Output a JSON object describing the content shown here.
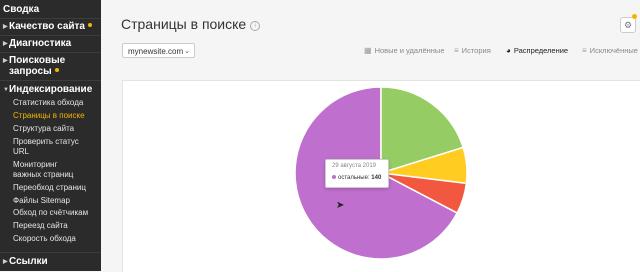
{
  "sidebar": {
    "items": [
      {
        "label": "Сводка"
      },
      {
        "label": "Качество сайта"
      },
      {
        "label": "Диагностика"
      },
      {
        "label": "Поисковые"
      },
      {
        "label": "запросы"
      },
      {
        "label": "Индексирование"
      },
      {
        "label": "Ссылки"
      }
    ],
    "subitems": [
      {
        "label": "Статистика обхода"
      },
      {
        "label": "Страницы в поиске"
      },
      {
        "label": "Структура сайта"
      },
      {
        "label": "Проверить статус"
      },
      {
        "label": "URL"
      },
      {
        "label": "Мониторинг"
      },
      {
        "label": "важных страниц"
      },
      {
        "label": "Переобход страниц"
      },
      {
        "label": "Файлы Sitemap"
      },
      {
        "label": "Обход по счётчикам"
      },
      {
        "label": "Переезд сайта"
      },
      {
        "label": "Скорость обхода"
      }
    ]
  },
  "header": {
    "title": "Страницы в поиске",
    "info_icon": "info-icon",
    "settings_icon": "gear-icon"
  },
  "site_selector": {
    "value": "mynewsite.com"
  },
  "tabs": [
    {
      "label": "Новые и удалённые",
      "icon": "table-icon",
      "active": false
    },
    {
      "label": "История",
      "icon": "list-icon",
      "active": false
    },
    {
      "label": "Распределение",
      "icon": "pie-icon",
      "active": true
    },
    {
      "label": "Исключённые",
      "icon": "list-icon",
      "active": false
    }
  ],
  "tooltip": {
    "date": "29 августа 2019",
    "series": "остальные:",
    "value": "140"
  },
  "chart_data": {
    "type": "pie",
    "slices": [
      {
        "value": 140,
        "color": "#bf6fce"
      },
      {
        "value": 42,
        "color": "#96cc64"
      },
      {
        "value": 14,
        "color": "#ffcc22"
      },
      {
        "value": 12,
        "color": "#f2573f"
      }
    ]
  },
  "colors": {
    "sidebar_bg": "#2b2b2b",
    "accent": "#f5b400"
  }
}
